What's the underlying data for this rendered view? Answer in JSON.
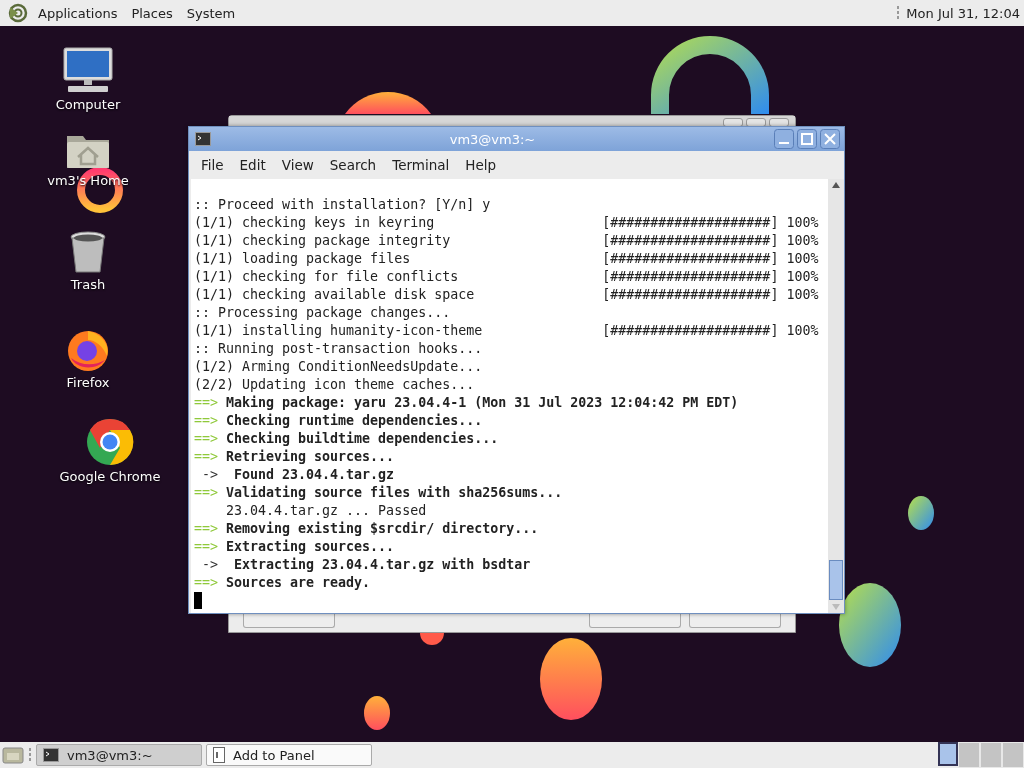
{
  "top_panel": {
    "menus": [
      {
        "label": "Applications"
      },
      {
        "label": "Places"
      },
      {
        "label": "System"
      }
    ],
    "clock": "Mon Jul 31, 12:04"
  },
  "desktop_icons": [
    {
      "kind": "computer",
      "label": "Computer"
    },
    {
      "kind": "home",
      "label": "vm3's Home"
    },
    {
      "kind": "trash",
      "label": "Trash"
    },
    {
      "kind": "firefox",
      "label": "Firefox"
    },
    {
      "kind": "chrome",
      "label": "Google Chrome"
    }
  ],
  "terminal": {
    "title": "vm3@vm3:~",
    "menu": [
      "File",
      "Edit",
      "View",
      "Search",
      "Terminal",
      "Help"
    ],
    "cursor": true,
    "lines": [
      {
        "kind": "plain",
        "text": ":: Proceed with installation? [Y/n] y"
      },
      {
        "kind": "progress",
        "text": "(1/1) checking keys in keyring",
        "bar": "[####################]",
        "percent": "100%"
      },
      {
        "kind": "progress",
        "text": "(1/1) checking package integrity",
        "bar": "[####################]",
        "percent": "100%"
      },
      {
        "kind": "progress",
        "text": "(1/1) loading package files",
        "bar": "[####################]",
        "percent": "100%"
      },
      {
        "kind": "progress",
        "text": "(1/1) checking for file conflicts",
        "bar": "[####################]",
        "percent": "100%"
      },
      {
        "kind": "progress",
        "text": "(1/1) checking available disk space",
        "bar": "[####################]",
        "percent": "100%"
      },
      {
        "kind": "plain",
        "text": ":: Processing package changes..."
      },
      {
        "kind": "progress",
        "text": "(1/1) installing humanity-icon-theme",
        "bar": "[####################]",
        "percent": "100%"
      },
      {
        "kind": "plain",
        "text": ":: Running post-transaction hooks..."
      },
      {
        "kind": "plain",
        "text": "(1/2) Arming ConditionNeedsUpdate..."
      },
      {
        "kind": "plain",
        "text": "(2/2) Updating icon theme caches..."
      },
      {
        "kind": "step",
        "marker": "==>",
        "text": "Making package: yaru 23.04.4-1 (Mon 31 Jul 2023 12:04:42 PM EDT)"
      },
      {
        "kind": "step",
        "marker": "==>",
        "text": "Checking runtime dependencies..."
      },
      {
        "kind": "step",
        "marker": "==>",
        "text": "Checking buildtime dependencies..."
      },
      {
        "kind": "step",
        "marker": "==>",
        "text": "Retrieving sources..."
      },
      {
        "kind": "sub",
        "marker": "->",
        "text": "Found 23.04.4.tar.gz"
      },
      {
        "kind": "step",
        "marker": "==>",
        "text": "Validating source files with sha256sums..."
      },
      {
        "kind": "detail",
        "text": "23.04.4.tar.gz ... Passed"
      },
      {
        "kind": "step",
        "marker": "==>",
        "text": "Removing existing $srcdir/ directory..."
      },
      {
        "kind": "step",
        "marker": "==>",
        "text": "Extracting sources..."
      },
      {
        "kind": "sub",
        "marker": "->",
        "text": "Extracting 23.04.4.tar.gz with bsdtar"
      },
      {
        "kind": "step",
        "marker": "==>",
        "text": "Sources are ready."
      }
    ]
  },
  "taskbar": {
    "tasks": [
      {
        "kind": "terminal",
        "label": "vm3@vm3:~",
        "selected": true
      },
      {
        "kind": "dialog",
        "label": "Add to Panel",
        "selected": false
      }
    ],
    "workspaces": [
      {
        "selected": true
      },
      {
        "selected": false
      },
      {
        "selected": false
      },
      {
        "selected": false
      }
    ]
  }
}
